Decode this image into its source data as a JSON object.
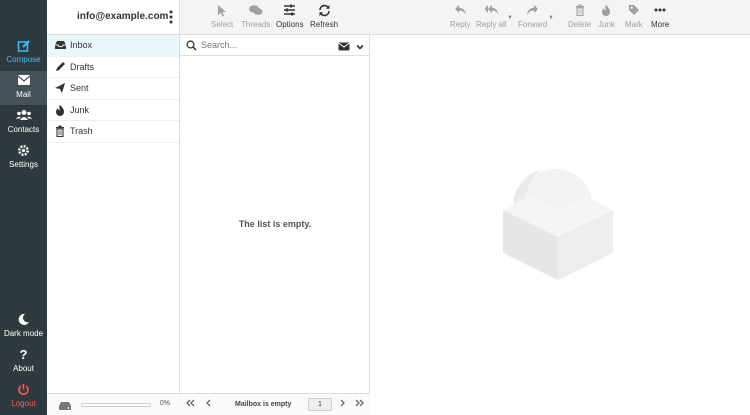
{
  "account": {
    "email": "info@example.com"
  },
  "nav": {
    "compose": "Compose",
    "mail": "Mail",
    "contacts": "Contacts",
    "settings": "Settings",
    "dark_mode": "Dark mode",
    "about": "About",
    "logout": "Logout"
  },
  "folders": {
    "items": [
      {
        "label": "Inbox",
        "icon": "inbox-icon",
        "selected": true
      },
      {
        "label": "Drafts",
        "icon": "pencil-icon"
      },
      {
        "label": "Sent",
        "icon": "paper-plane-icon"
      },
      {
        "label": "Junk",
        "icon": "fire-icon"
      },
      {
        "label": "Trash",
        "icon": "trash-icon"
      }
    ],
    "quota_percent": "0%"
  },
  "list_toolbar": {
    "select": "Select",
    "threads": "Threads",
    "options": "Options",
    "refresh": "Refresh"
  },
  "search": {
    "placeholder": "Search..."
  },
  "message_list": {
    "empty_text": "The list is empty.",
    "footer_status": "Mailbox is empty",
    "page": "1"
  },
  "message_toolbar": {
    "reply": "Reply",
    "reply_all": "Reply all",
    "forward": "Forward",
    "delete": "Delete",
    "junk": "Junk",
    "mark": "Mark",
    "more": "More"
  },
  "colors": {
    "rail_bg": "#2f3a3f",
    "accent": "#37beff",
    "logout": "#ff5552",
    "selected_folder": "#e9f7fd"
  }
}
